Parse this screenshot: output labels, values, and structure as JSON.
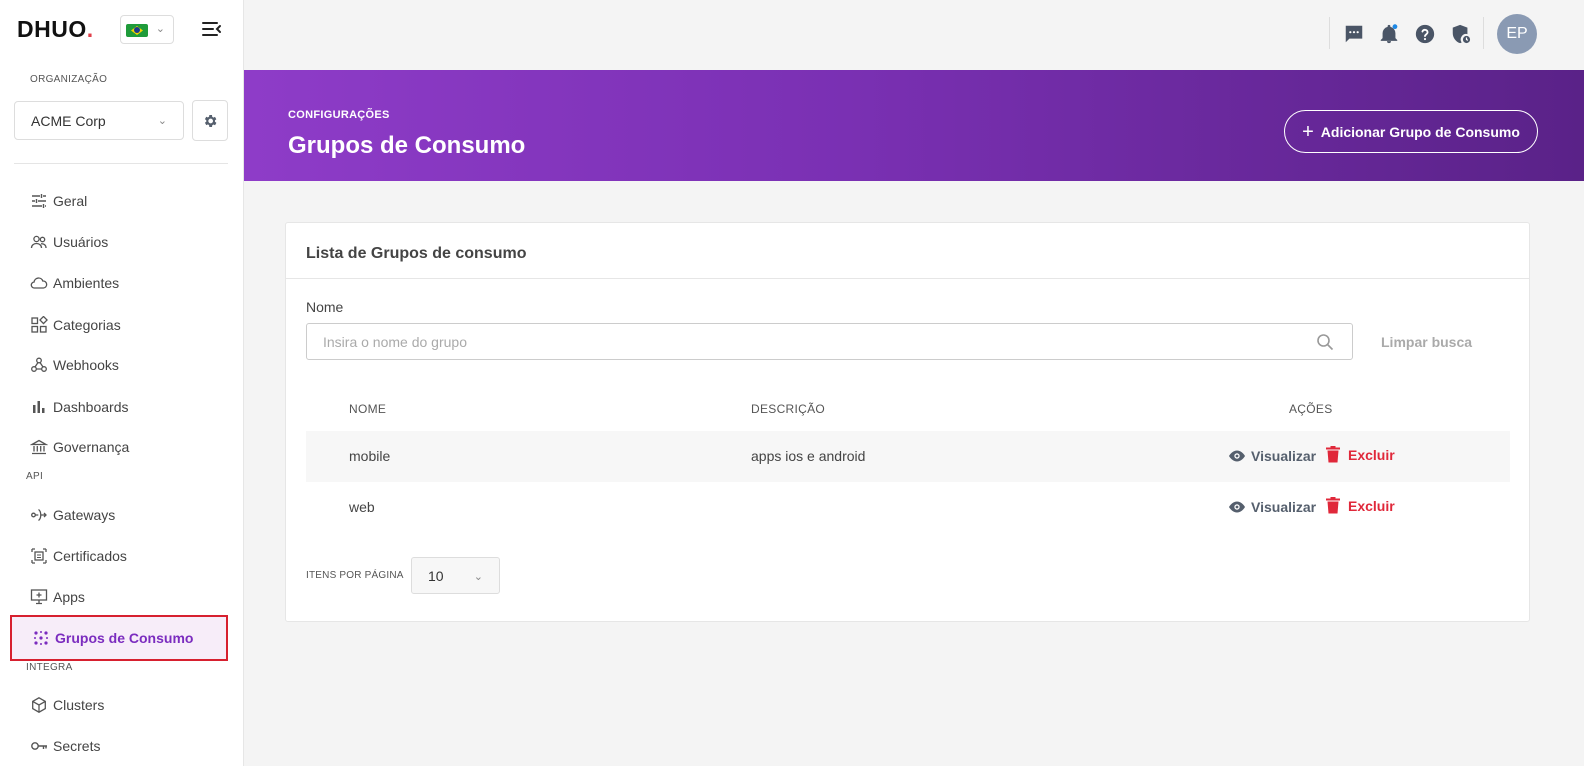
{
  "sidebar": {
    "logo_main": "DHUO",
    "logo_dot": ".",
    "org_label": "ORGANIZAÇÃO",
    "org_value": "ACME Corp",
    "items_general": [
      {
        "label": "Geral",
        "icon": "sliders-icon"
      },
      {
        "label": "Usuários",
        "icon": "users-icon"
      },
      {
        "label": "Ambientes",
        "icon": "cloud-icon"
      },
      {
        "label": "Categorias",
        "icon": "category-grid-icon"
      },
      {
        "label": "Webhooks",
        "icon": "webhook-icon"
      },
      {
        "label": "Dashboards",
        "icon": "bar-chart-icon"
      },
      {
        "label": "Governança",
        "icon": "bank-icon"
      }
    ],
    "section_api": "API",
    "items_api": [
      {
        "label": "Gateways",
        "icon": "gateway-icon"
      },
      {
        "label": "Certificados",
        "icon": "certificate-icon"
      },
      {
        "label": "Apps",
        "icon": "apps-icon"
      },
      {
        "label": "Grupos de Consumo",
        "icon": "dots-grid-icon",
        "active": true
      }
    ],
    "section_integra": "INTEGRA",
    "items_integra": [
      {
        "label": "Clusters",
        "icon": "cube-icon"
      },
      {
        "label": "Secrets",
        "icon": "key-icon"
      }
    ]
  },
  "topbar": {
    "avatar_initials": "EP",
    "icons": [
      "chat-icon",
      "bell-icon",
      "help-icon",
      "shield-clock-icon"
    ]
  },
  "header": {
    "breadcrumb": "CONFIGURAÇÕES",
    "title": "Grupos de Consumo",
    "add_button": "Adicionar Grupo de Consumo"
  },
  "card": {
    "title": "Lista de Grupos de consumo",
    "field_label": "Nome",
    "search_placeholder": "Insira o nome do grupo",
    "clear_label": "Limpar busca",
    "columns": {
      "name": "NOME",
      "description": "DESCRIÇÃO",
      "actions": "AÇÕES"
    },
    "rows": [
      {
        "name": "mobile",
        "description": "apps ios e android"
      },
      {
        "name": "web",
        "description": ""
      }
    ],
    "view_label": "Visualizar",
    "delete_label": "Excluir",
    "per_page_label": "ITENS POR PÁGINA",
    "per_page_value": "10"
  },
  "colors": {
    "accent": "#7b2cbf",
    "danger": "#e0283a",
    "banner_start": "#8e3cc8",
    "banner_end": "#5a2288"
  }
}
